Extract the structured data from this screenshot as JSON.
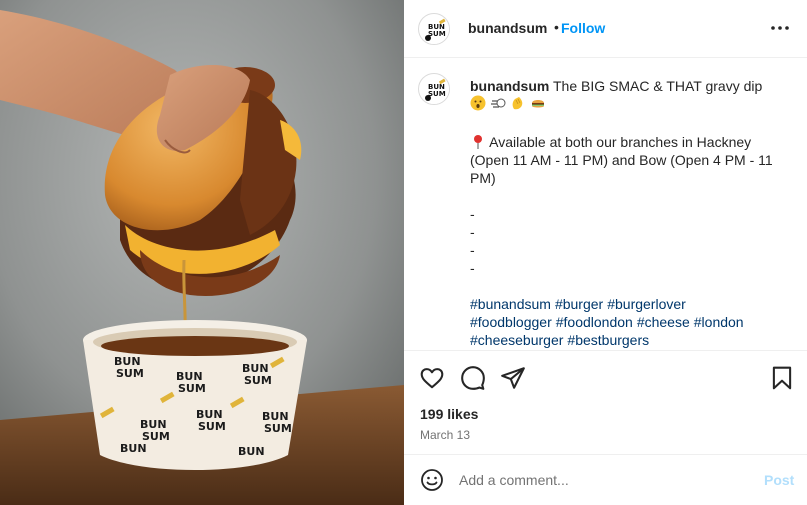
{
  "post": {
    "photo_icon": "burger-photo",
    "brand_logo_text": "BUN SUM"
  },
  "header": {
    "username": "bunandsum",
    "separator": "•",
    "follow_label": "Follow",
    "more_icon": "more-horizontal-icon"
  },
  "caption": {
    "username": "bunandsum",
    "title": "The BIG SMAC & THAT gravy dip",
    "emoji_icons": [
      "astonished-face-icon",
      "dash-icon",
      "clapping-hands-icon",
      "burger-icon"
    ],
    "location_icon": "round-pushpin-icon",
    "branches_line1": "Available at both our branches in Hackney",
    "branches_line2": "(Open 11 AM - 11 PM) and Bow (Open 4 PM - 11",
    "branches_line3": "PM)",
    "dashes": [
      "-",
      "-",
      "-",
      "-"
    ],
    "hashtags": [
      "#bunandsum",
      "#burger",
      "#burgerlover",
      "#foodblogger",
      "#foodlondon",
      "#cheese",
      "#london",
      "#cheeseburger",
      "#bestburgers"
    ]
  },
  "actions": {
    "like_icon": "heart-icon",
    "comment_icon": "comment-icon",
    "share_icon": "paper-plane-icon",
    "save_icon": "bookmark-icon",
    "likes_text": "199 likes",
    "date_text": "March 13"
  },
  "comment_bar": {
    "emoji_icon": "smiley-icon",
    "placeholder": "Add a comment...",
    "post_label": "Post"
  },
  "colors": {
    "link_blue": "#0095f6",
    "hashtag": "#00376b",
    "post_disabled": "#b2dffc",
    "muted": "#737373"
  }
}
